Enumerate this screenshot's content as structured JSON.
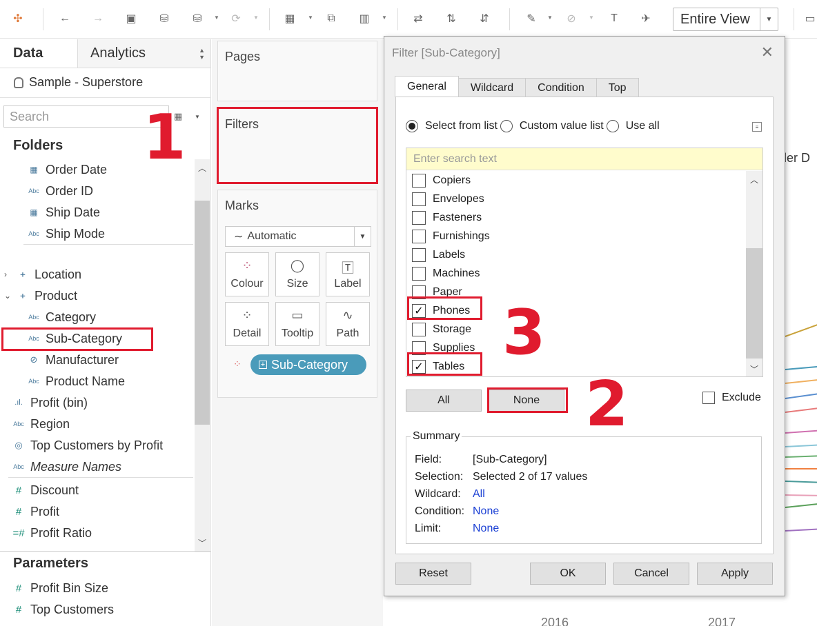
{
  "toolbar": {
    "entire_view": "Entire View"
  },
  "left": {
    "tab_data": "Data",
    "tab_analytics": "Analytics",
    "datasource": "Sample - Superstore",
    "search_placeholder": "Search",
    "folders_heading": "Folders",
    "fields": {
      "order_date": "Order Date",
      "order_id": "Order ID",
      "ship_date": "Ship Date",
      "ship_mode": "Ship Mode",
      "location": "Location",
      "product": "Product",
      "category": "Category",
      "sub_category": "Sub-Category",
      "manufacturer": "Manufacturer",
      "product_name": "Product Name",
      "profit_bin": "Profit (bin)",
      "region": "Region",
      "top_customers_by_profit": "Top Customers by Profit",
      "measure_names": "Measure Names",
      "discount": "Discount",
      "profit": "Profit",
      "profit_ratio": "Profit Ratio"
    },
    "icon_abc": "Abc",
    "params_heading": "Parameters",
    "params": {
      "profit_bin_size": "Profit Bin Size",
      "top_customers": "Top Customers"
    }
  },
  "shelves": {
    "pages": "Pages",
    "filters": "Filters",
    "marks": "Marks",
    "mark_type": "Automatic",
    "colour": "Colour",
    "size": "Size",
    "label": "Label",
    "detail": "Detail",
    "tooltip": "Tooltip",
    "path": "Path",
    "pill": "Sub-Category"
  },
  "canvas": {
    "partial_header": "rder D",
    "year_2016": "2016",
    "year_2017": "2017"
  },
  "dialog": {
    "title": "Filter [Sub-Category]",
    "tabs": [
      "General",
      "Wildcard",
      "Condition",
      "Top"
    ],
    "radio_select": "Select from list",
    "radio_custom": "Custom value list",
    "radio_all": "Use all",
    "search_placeholder": "Enter search text",
    "items": [
      {
        "label": "Copiers",
        "checked": false
      },
      {
        "label": "Envelopes",
        "checked": false
      },
      {
        "label": "Fasteners",
        "checked": false
      },
      {
        "label": "Furnishings",
        "checked": false
      },
      {
        "label": "Labels",
        "checked": false
      },
      {
        "label": "Machines",
        "checked": false
      },
      {
        "label": "Paper",
        "checked": false
      },
      {
        "label": "Phones",
        "checked": true
      },
      {
        "label": "Storage",
        "checked": false
      },
      {
        "label": "Supplies",
        "checked": false
      },
      {
        "label": "Tables",
        "checked": true
      }
    ],
    "btn_all": "All",
    "btn_none": "None",
    "exclude": "Exclude",
    "summary_label": "Summary",
    "summary": {
      "field_k": "Field:",
      "field_v": "[Sub-Category]",
      "selection_k": "Selection:",
      "selection_v": "Selected 2 of 17 values",
      "wildcard_k": "Wildcard:",
      "wildcard_v": "All",
      "condition_k": "Condition:",
      "condition_v": "None",
      "limit_k": "Limit:",
      "limit_v": "None"
    },
    "btn_reset": "Reset",
    "btn_ok": "OK",
    "btn_cancel": "Cancel",
    "btn_apply": "Apply"
  },
  "annotations": {
    "n1": "1",
    "n2": "2",
    "n3": "3"
  },
  "colors": {
    "annotation": "#e01b2e",
    "pill": "#4a9bba",
    "link": "#1a3fd4"
  }
}
